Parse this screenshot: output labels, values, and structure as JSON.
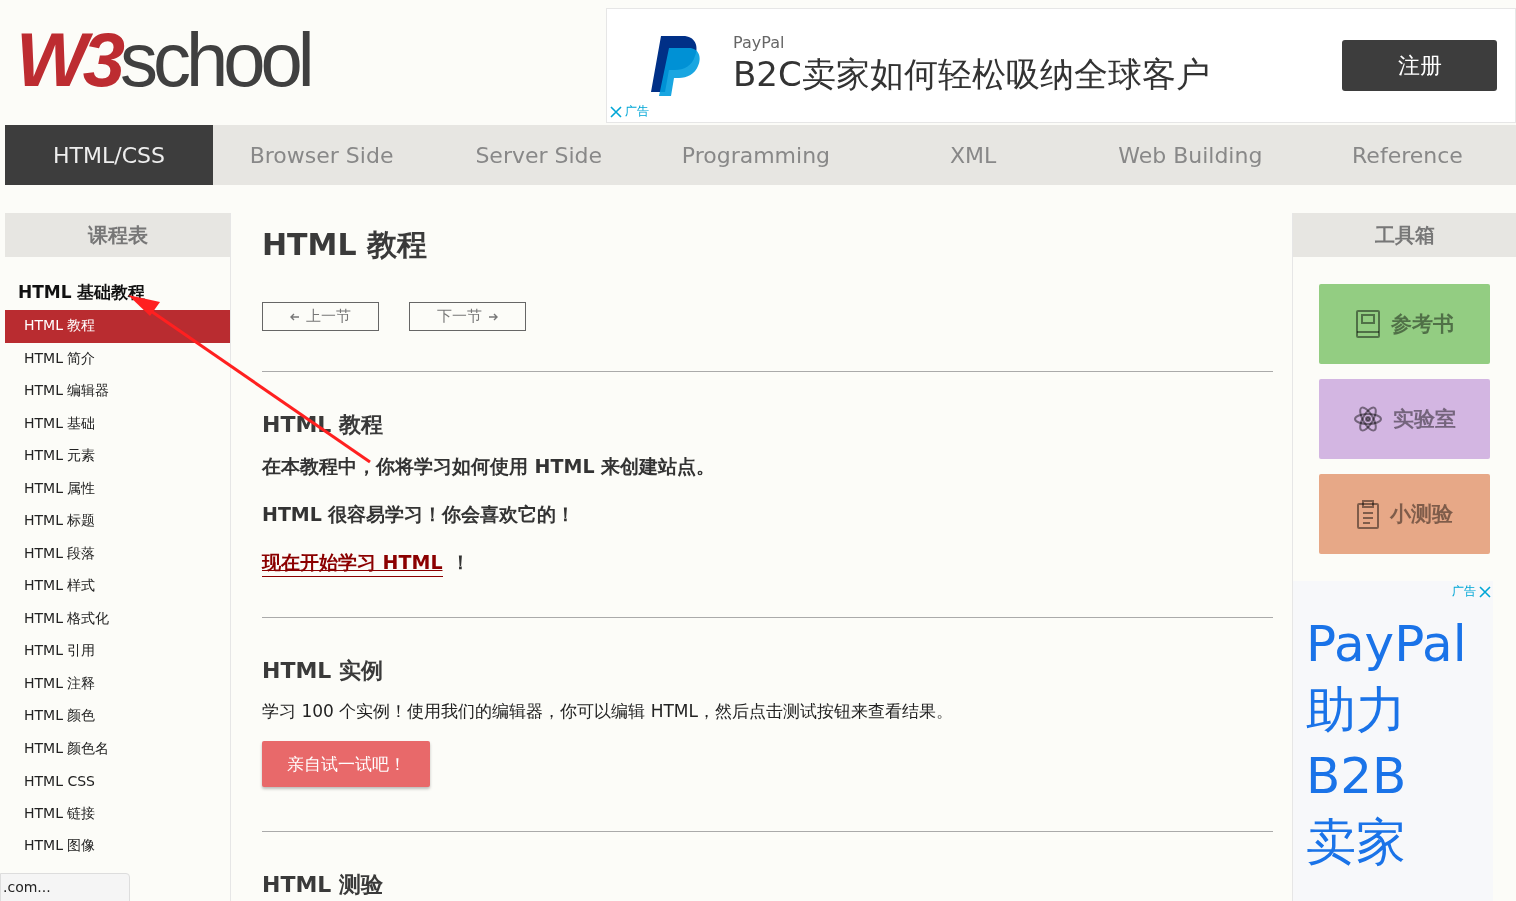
{
  "header": {
    "logo": {
      "mark": "W3",
      "word": "school"
    },
    "ad": {
      "brand": "PayPal",
      "headline": "B2C卖家如何轻松吸纳全球客户",
      "button": "注册",
      "label": "广告"
    }
  },
  "nav": [
    {
      "label": "HTML/CSS",
      "selected": true
    },
    {
      "label": "Browser Side",
      "selected": false
    },
    {
      "label": "Server Side",
      "selected": false
    },
    {
      "label": "Programming",
      "selected": false
    },
    {
      "label": "XML",
      "selected": false
    },
    {
      "label": "Web Building",
      "selected": false
    },
    {
      "label": "Reference",
      "selected": false
    }
  ],
  "sidebar": {
    "title": "课程表",
    "section": "HTML 基础教程",
    "items": [
      {
        "label": "HTML 教程",
        "selected": true
      },
      {
        "label": "HTML 简介",
        "selected": false
      },
      {
        "label": "HTML 编辑器",
        "selected": false
      },
      {
        "label": "HTML 基础",
        "selected": false
      },
      {
        "label": "HTML 元素",
        "selected": false
      },
      {
        "label": "HTML 属性",
        "selected": false
      },
      {
        "label": "HTML 标题",
        "selected": false
      },
      {
        "label": "HTML 段落",
        "selected": false
      },
      {
        "label": "HTML 样式",
        "selected": false
      },
      {
        "label": "HTML 格式化",
        "selected": false
      },
      {
        "label": "HTML 引用",
        "selected": false
      },
      {
        "label": "HTML 注释",
        "selected": false
      },
      {
        "label": "HTML 颜色",
        "selected": false
      },
      {
        "label": "HTML 颜色名",
        "selected": false
      },
      {
        "label": "HTML CSS",
        "selected": false
      },
      {
        "label": "HTML 链接",
        "selected": false
      },
      {
        "label": "HTML 图像",
        "selected": false
      }
    ]
  },
  "main": {
    "title": "HTML 教程",
    "prev": "上一节",
    "next": "下一节",
    "sections": [
      {
        "heading": "HTML 教程",
        "blocks": [
          {
            "kind": "strong",
            "text": "在本教程中，你将学习如何使用 HTML 来创建站点。"
          },
          {
            "kind": "strong",
            "text": "HTML 很容易学习！你会喜欢它的！"
          },
          {
            "kind": "link",
            "text": "现在开始学习 HTML",
            "suffix": "！"
          }
        ]
      },
      {
        "heading": "HTML 实例",
        "blocks": [
          {
            "kind": "plain",
            "text": "学习 100 个实例！使用我们的编辑器，你可以编辑 HTML，然后点击测试按钮来查看结果。"
          },
          {
            "kind": "button",
            "text": "亲自试一试吧！"
          }
        ]
      },
      {
        "heading": "HTML 测验"
      }
    ]
  },
  "toolbox": {
    "title": "工具箱",
    "buttons": [
      {
        "label": "参考书",
        "kind": "book",
        "color": "#93cd82"
      },
      {
        "label": "实验室",
        "kind": "atom",
        "color": "#d3b6e2"
      },
      {
        "label": "小测验",
        "kind": "clipboard",
        "color": "#e7a887"
      }
    ]
  },
  "side_ad": {
    "label": "广告",
    "lines": [
      "PayPal",
      "助力",
      "B2B",
      "卖家"
    ]
  },
  "status_tooltip": ".com..."
}
